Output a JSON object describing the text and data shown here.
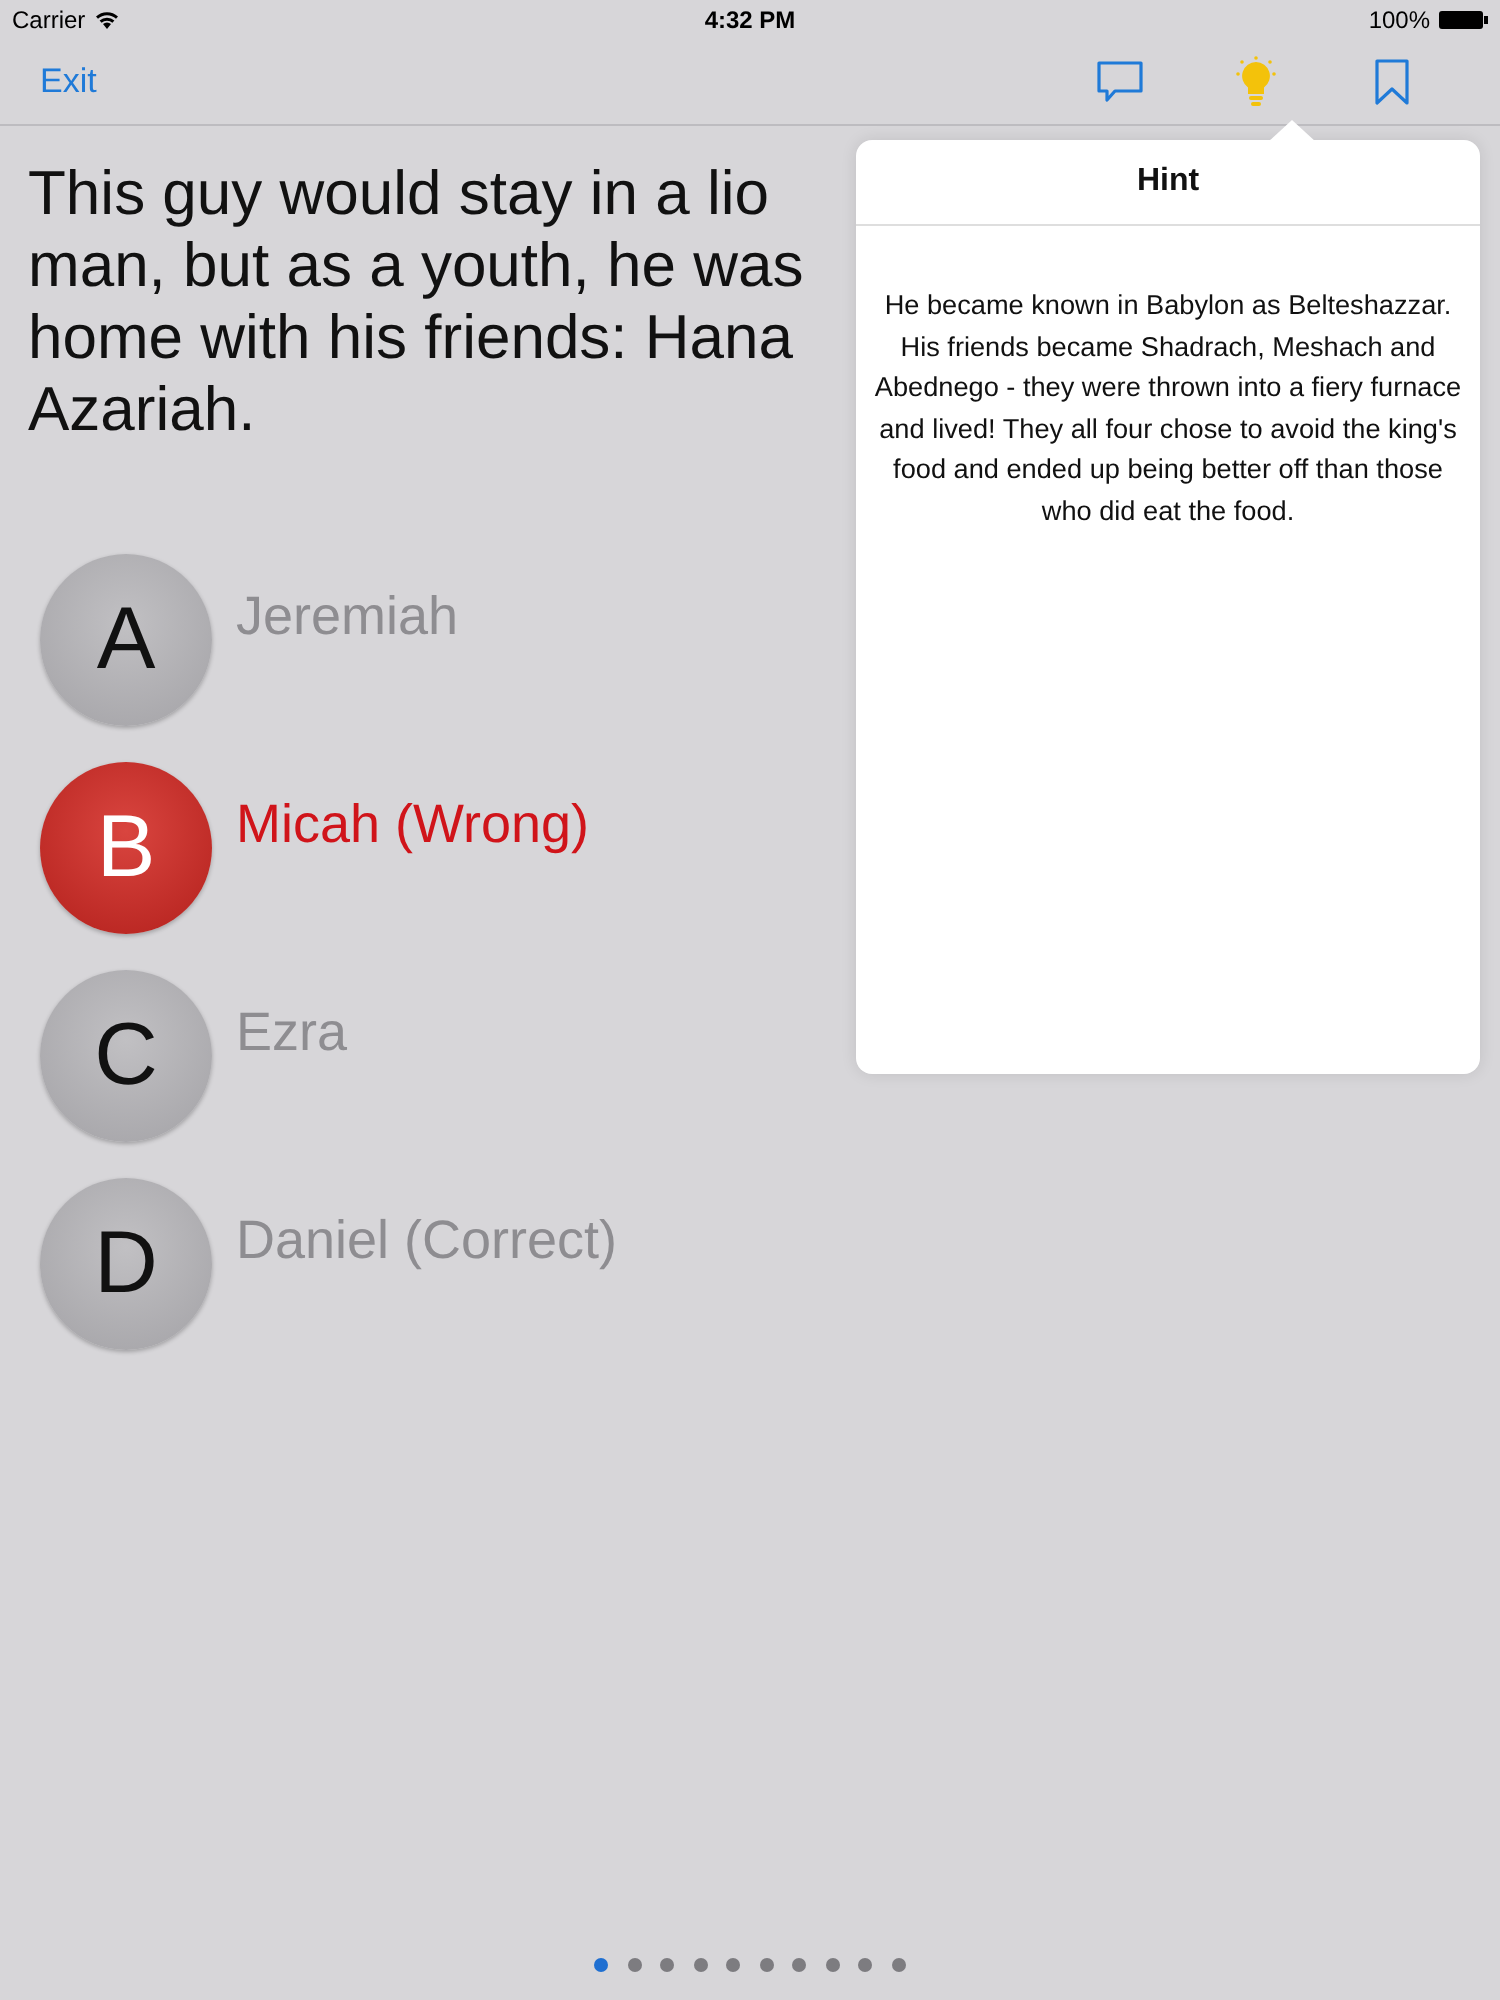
{
  "status_bar": {
    "carrier": "Carrier",
    "time": "4:32 PM",
    "battery": "100%"
  },
  "nav_bar": {
    "exit": "Exit",
    "tools": [
      {
        "kind": "comment",
        "selected": false
      },
      {
        "kind": "hint",
        "selected": true
      },
      {
        "kind": "bookmark",
        "selected": false
      }
    ]
  },
  "question": {
    "lines": [
      "This guy would stay in a lio",
      "man, but as a youth, he was",
      "home with his friends: Hana",
      "Azariah."
    ]
  },
  "answers": [
    {
      "letter": "A",
      "text": "Jeremiah",
      "wrong": false
    },
    {
      "letter": "B",
      "text": "Micah (Wrong)",
      "wrong": true
    },
    {
      "letter": "C",
      "text": "Ezra",
      "wrong": false
    },
    {
      "letter": "D",
      "text": "Daniel (Correct)",
      "wrong": false
    }
  ],
  "hint_popover": {
    "title": "Hint",
    "body": "He became known in Babylon as Belteshazzar. His friends became Shadrach, Meshach and Abednego - they were thrown into a fiery furnace and lived! They all four chose to avoid the king's food and ended up being better off than those who did eat the food."
  },
  "page_dots": [
    {
      "selected": true
    },
    {
      "selected": false
    },
    {
      "selected": false
    },
    {
      "selected": false
    },
    {
      "selected": false
    },
    {
      "selected": false
    },
    {
      "selected": false
    },
    {
      "selected": false
    },
    {
      "selected": false
    },
    {
      "selected": false
    }
  ]
}
